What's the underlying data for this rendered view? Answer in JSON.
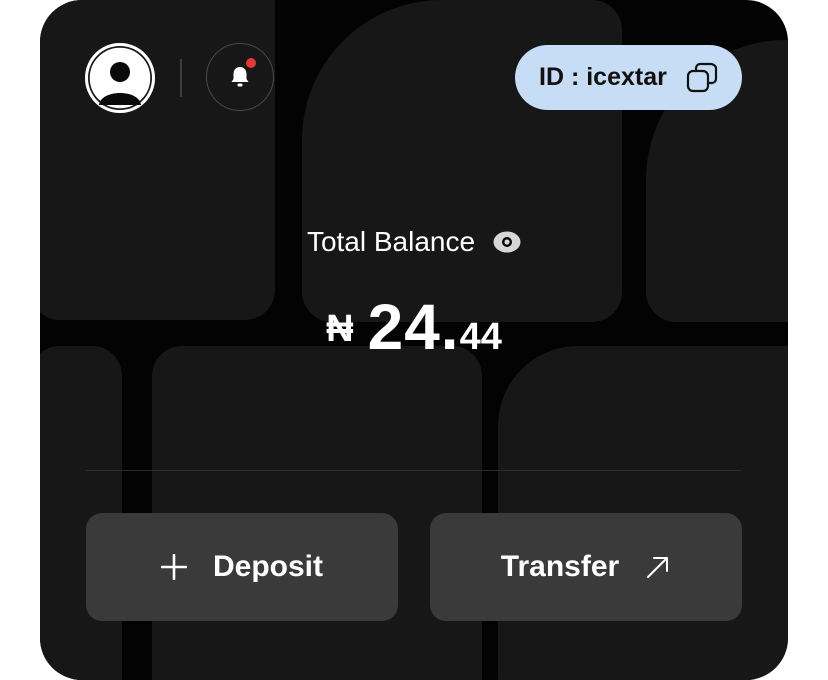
{
  "header": {
    "avatar_icon": "user-avatar-icon",
    "notification_icon": "bell-icon",
    "notification_badge_color": "#e53935",
    "user_id_label": "ID : icextar",
    "copy_icon": "copy-icon"
  },
  "balance": {
    "label": "Total Balance",
    "visibility_icon": "eye-icon",
    "currency_symbol": "₦",
    "integer_part": "24.",
    "decimal_part": "44"
  },
  "actions": {
    "deposit": {
      "label": "Deposit",
      "icon": "plus-icon"
    },
    "transfer": {
      "label": "Transfer",
      "icon": "arrow-up-right-icon"
    }
  },
  "colors": {
    "card_background": "#030303",
    "pill_background": "#c7dcf5",
    "button_background": "#3a3a3a"
  }
}
